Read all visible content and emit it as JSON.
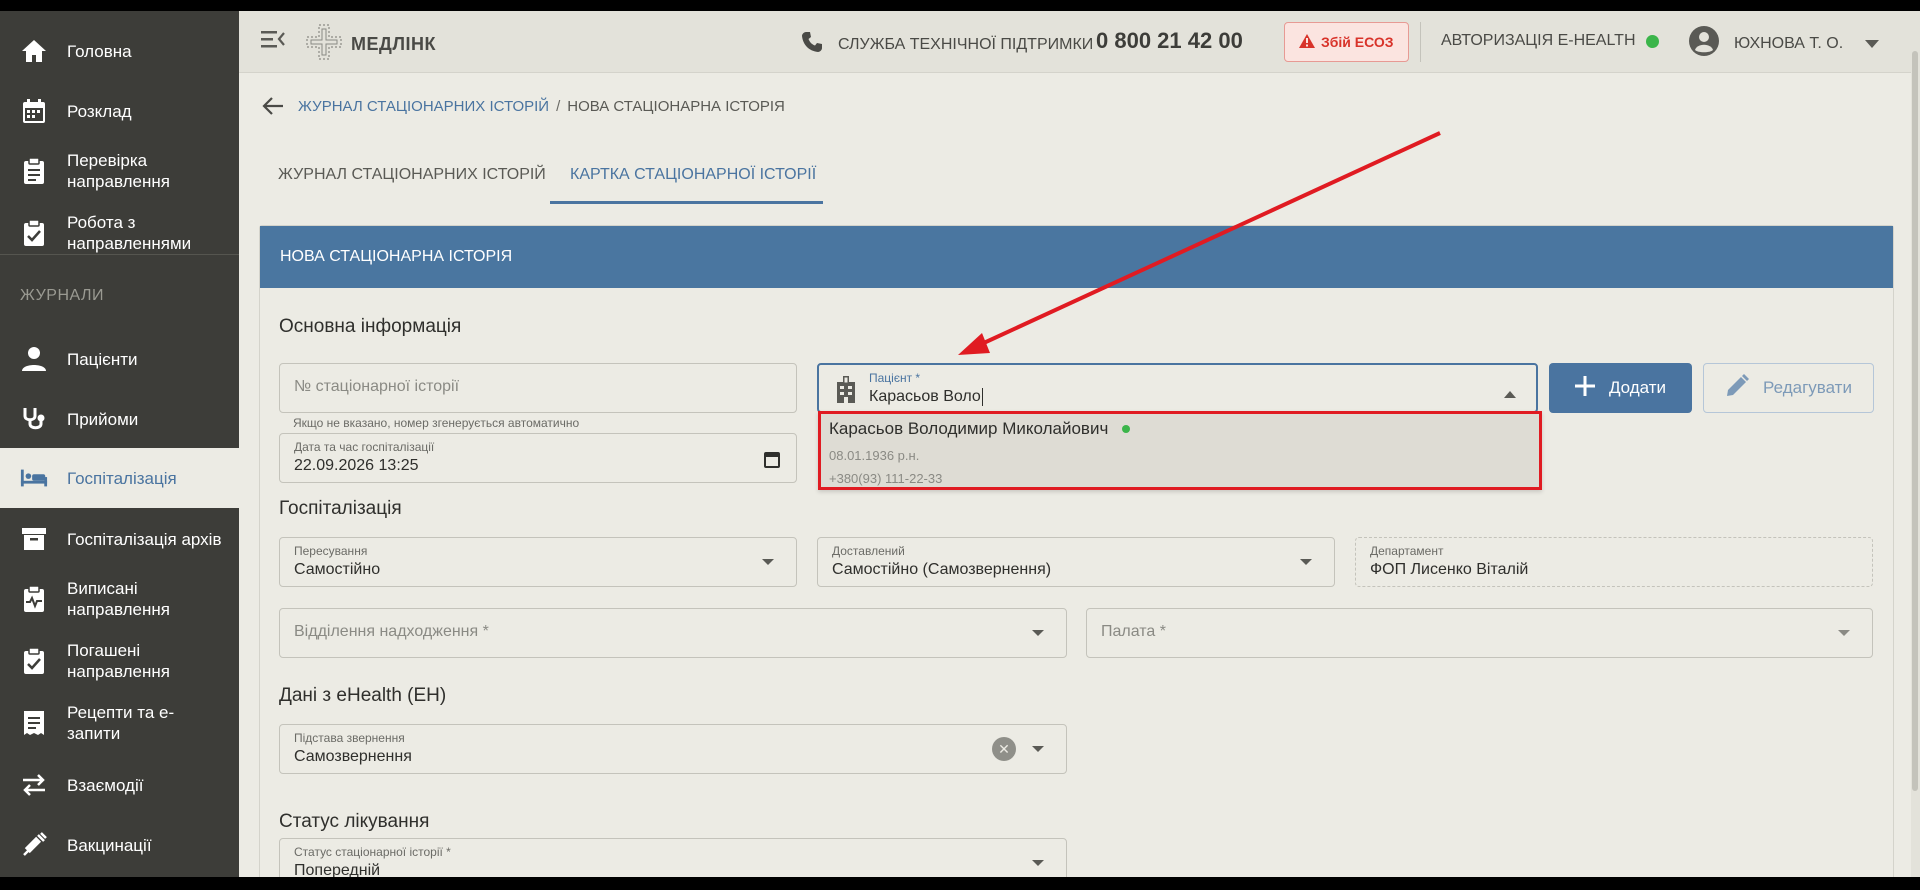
{
  "sidebar": {
    "items": [
      {
        "label": "Головна",
        "icon": "home-icon"
      },
      {
        "label": "Розклад",
        "icon": "calendar-icon"
      },
      {
        "label": "Перевірка направлення",
        "icon": "clipboard-icon"
      },
      {
        "label": "Робота з направленнями",
        "icon": "clipboard-check-icon"
      },
      {
        "label": "Пацієнти",
        "icon": "person-icon"
      },
      {
        "label": "Прийоми",
        "icon": "stethoscope-icon"
      },
      {
        "label": "Госпіталізація",
        "icon": "bed-icon"
      },
      {
        "label": "Госпіталізація архів",
        "icon": "archive-icon"
      },
      {
        "label": "Виписані направлення",
        "icon": "clipboard-pulse-icon"
      },
      {
        "label": "Погашені направлення",
        "icon": "clipboard-check-icon"
      },
      {
        "label": "Рецепти та е-запити",
        "icon": "receipt-icon"
      },
      {
        "label": "Взаємодії",
        "icon": "swap-icon"
      },
      {
        "label": "Вакцинації",
        "icon": "syringe-icon"
      }
    ],
    "section_label": "ЖУРНАЛИ"
  },
  "topbar": {
    "logo": "МЕДЛІНК",
    "support_label": "СЛУЖБА ТЕХНІЧНОЇ ПІДТРИМКИ",
    "support_phone": "0 800 21 42 00",
    "ecoz_label": "Збій ЕСОЗ",
    "ehealth_label": "АВТОРИЗАЦІЯ E-HEALTH",
    "user_name": "ЮХНОВА Т. О."
  },
  "breadcrumb": {
    "parent": "ЖУРНАЛ СТАЦІОНАРНИХ ІСТОРІЙ",
    "separator": "/",
    "current": "НОВА СТАЦІОНАРНА ІСТОРІЯ"
  },
  "tabs": [
    {
      "label": "ЖУРНАЛ СТАЦІОНАРНИХ ІСТОРІЙ"
    },
    {
      "label": "КАРТКА СТАЦІОНАРНОЇ ІСТОРІЇ"
    }
  ],
  "card": {
    "title": "НОВА СТАЦІОНАРНА ІСТОРІЯ",
    "sections": {
      "main": "Основна інформація",
      "hospitalization": "Госпіталізація",
      "ehealth": "Дані з eHealth (ЕН)",
      "status": "Статус лікування"
    },
    "history_number": {
      "placeholder": "№ стаціонарної історії",
      "hint": "Якщо не вказано, номер згенерується автоматично"
    },
    "datetime": {
      "label": "Дата та час госпіталізації",
      "value": "22.09.2026 13:25"
    },
    "patient": {
      "label": "Пацієнт *",
      "value": "Карасьов Воло"
    },
    "add_button": "Додати",
    "edit_button": "Редагувати",
    "dropdown": {
      "name": "Карасьов Володимир Миколайович",
      "dob": "08.01.1936 р.н.",
      "phone": "+380(93) 111-22-33"
    },
    "movement": {
      "label": "Пересування",
      "value": "Самостійно"
    },
    "delivered": {
      "label": "Доставлений",
      "value": "Самостійно (Самозвернення)"
    },
    "department": {
      "label": "Департамент",
      "value": "ФОП Лисенко Віталій"
    },
    "admission_dept": {
      "placeholder": "Відділення надходження *"
    },
    "ward": {
      "placeholder": "Палата *"
    },
    "reason": {
      "label": "Підстава звернення",
      "value": "Самозвернення"
    },
    "status_field": {
      "label": "Статус стаціонарної історії *",
      "value": "Попередній"
    }
  },
  "colors": {
    "sidebar": "#3d3d39",
    "accent": "#4a74a0",
    "highlight": "#e01b22",
    "online": "#3bb54a"
  }
}
